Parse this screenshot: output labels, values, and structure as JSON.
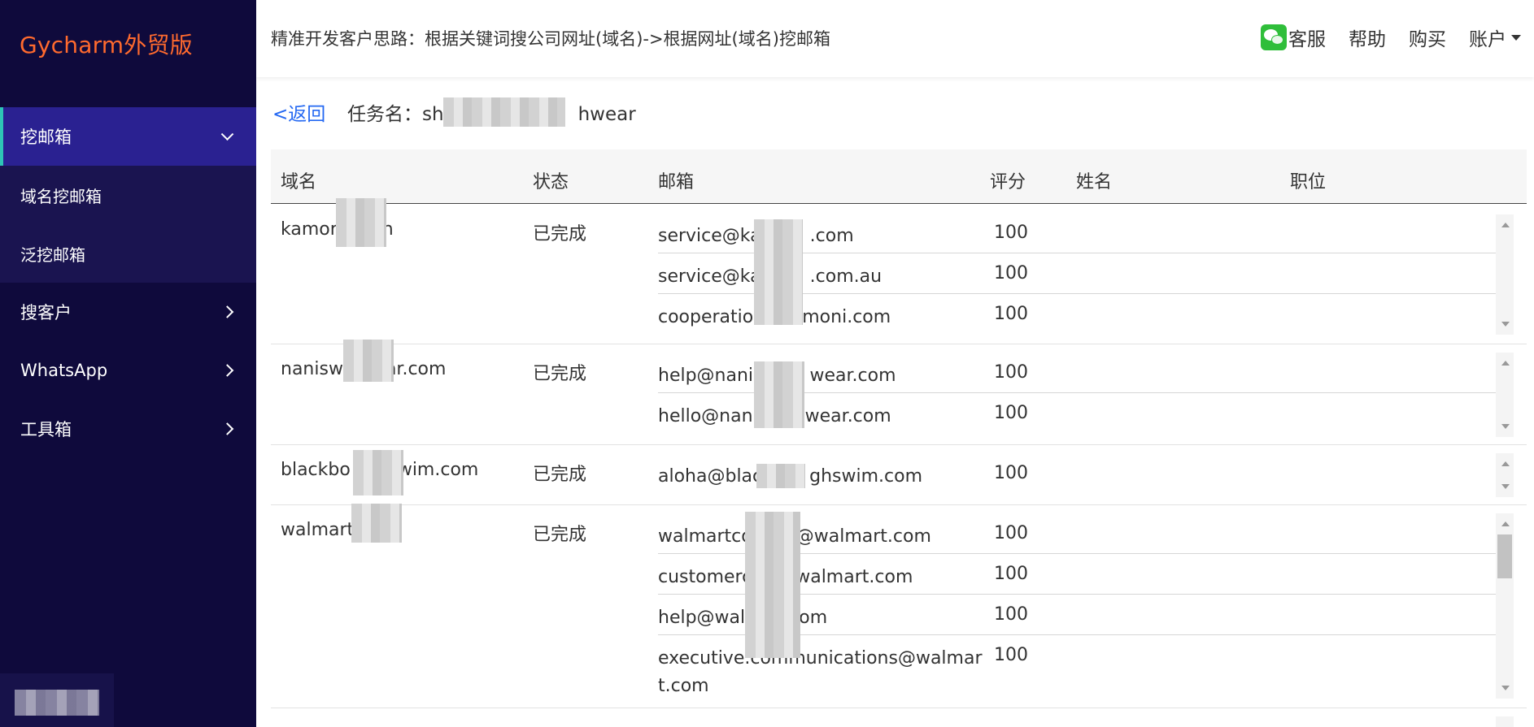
{
  "sidebar": {
    "logo": "Gycharm外贸版",
    "items": [
      {
        "label": "挖邮箱"
      },
      {
        "label": "域名挖邮箱"
      },
      {
        "label": "泛挖邮箱"
      },
      {
        "label": "搜客户"
      },
      {
        "label": "WhatsApp"
      },
      {
        "label": "工具箱"
      }
    ]
  },
  "header": {
    "tip": "精准开发客户思路：根据关键词搜公司网址(域名)->根据网址(域名)挖邮箱",
    "links": [
      "客服",
      "帮助",
      "购买",
      "账户"
    ]
  },
  "task": {
    "back_label": "<返回",
    "name_label": "任务名：sh",
    "name_tail": "hwear"
  },
  "table": {
    "headers": [
      "域名",
      "状态",
      "邮箱",
      "评分",
      "姓名",
      "职位"
    ],
    "rows": [
      {
        "domain": "kamor",
        "domain_tail": "n",
        "status": "已完成",
        "emails": [
          {
            "email": "service@ka",
            "tail": ".com",
            "score": "100"
          },
          {
            "email": "service@ka",
            "tail": ".com.au",
            "score": "100"
          },
          {
            "email": "cooperatio",
            "tail": "moni.com",
            "score": "100"
          }
        ]
      },
      {
        "domain": "nanisw",
        "domain_tail": "ar.com",
        "status": "已完成",
        "emails": [
          {
            "email": "help@nanis",
            "tail": "wear.com",
            "score": "100"
          },
          {
            "email": "hello@nani",
            "tail": "wear.com",
            "score": "100"
          }
        ]
      },
      {
        "domain": "blackbo",
        "domain_tail": "wim.com",
        "status": "已完成",
        "emails": [
          {
            "email": "aloha@blac",
            "tail": "ghswim.com",
            "score": "100"
          }
        ]
      },
      {
        "domain": "walmart",
        "domain_tail": "",
        "status": "已完成",
        "emails": [
          {
            "email": "walmartco",
            "tail": "@walmart.com",
            "score": "100"
          },
          {
            "email": "customerc",
            "tail": "walmart.com",
            "score": "100"
          },
          {
            "email": "help@wal",
            "tail": "com",
            "score": "100"
          },
          {
            "email": "executive.communications@walmart.com",
            "tail": "",
            "score": "100"
          }
        ]
      }
    ]
  },
  "colors": {
    "sidebar_bg": "#0f0a3c",
    "sidebar_active": "#2a2191",
    "logo": "#ff6a2e",
    "link": "#2468f2"
  }
}
